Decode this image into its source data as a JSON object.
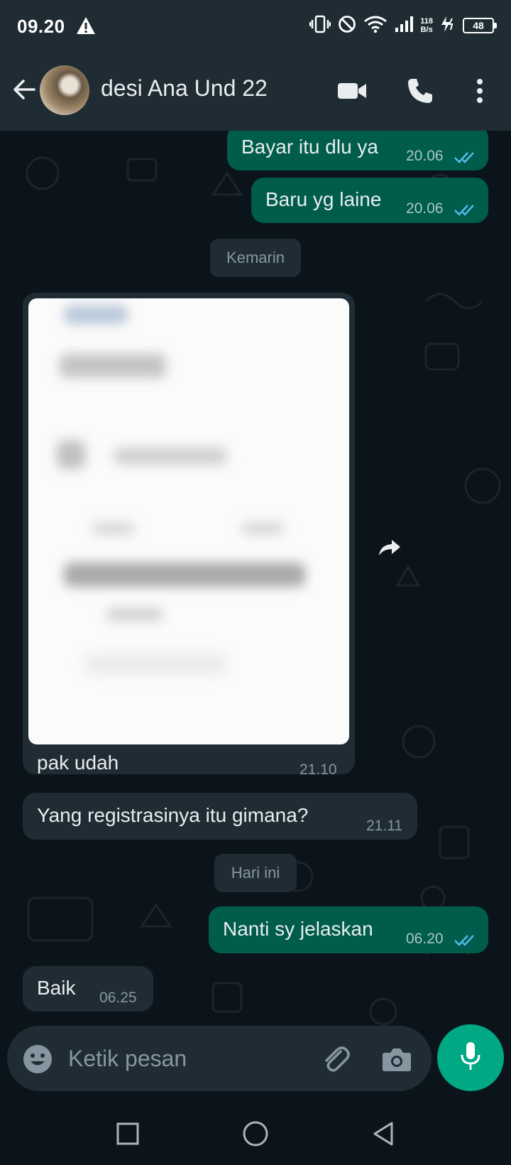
{
  "status_bar": {
    "time": "09.20",
    "net_speed_value": "118",
    "net_speed_unit": "B/s",
    "battery": "48"
  },
  "header": {
    "contact_name": "desi Ana Und 22"
  },
  "messages": [
    {
      "type": "out",
      "text": "Bayar itu dlu ya",
      "time": "20.06"
    },
    {
      "type": "out",
      "text": "Baru yg laine",
      "time": "20.06"
    },
    {
      "type": "date",
      "text": "Kemarin"
    },
    {
      "type": "in_image",
      "caption": "pak udah",
      "time": "21.10"
    },
    {
      "type": "in",
      "text": "Yang registrasinya itu gimana?",
      "time": "21.11"
    },
    {
      "type": "date",
      "text": "Hari ini"
    },
    {
      "type": "out",
      "text": "Nanti sy jelaskan",
      "time": "06.20"
    },
    {
      "type": "in",
      "text": "Baik",
      "time": "06.25"
    }
  ],
  "composer": {
    "placeholder": "Ketik pesan"
  },
  "colors": {
    "outgoing_bubble": "#005c4b",
    "incoming_bubble": "#1f2c34",
    "accent": "#00a884",
    "read_ticks": "#53bdeb",
    "background": "#0b141a"
  },
  "icons": [
    "warning-icon",
    "vibrate-icon",
    "dnd-icon",
    "wifi-icon",
    "signal-icon",
    "charging-icon",
    "back-arrow-icon",
    "video-call-icon",
    "phone-icon",
    "more-vert-icon",
    "forward-icon",
    "emoji-icon",
    "attach-icon",
    "camera-icon",
    "mic-icon",
    "nav-recents-icon",
    "nav-home-icon",
    "nav-back-icon"
  ]
}
